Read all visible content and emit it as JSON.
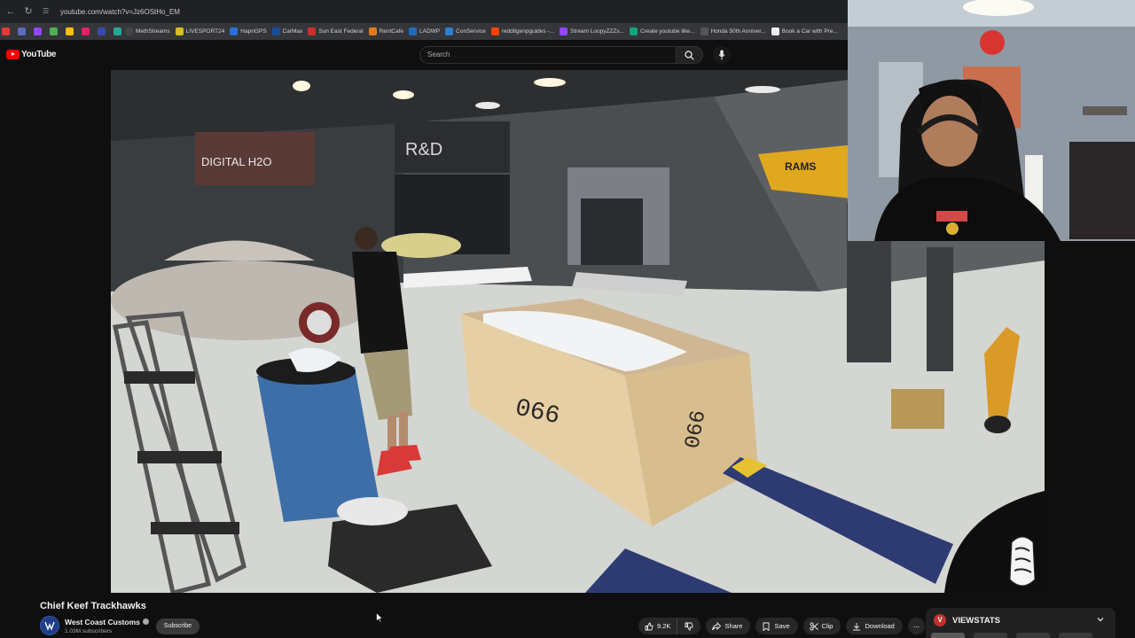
{
  "browser": {
    "url": "youtube.com/watch?v=Jz6OStHo_EM",
    "bookmarks": [
      {
        "label": "MethStreams",
        "color": "#444"
      },
      {
        "label": "LIVESPORT24",
        "color": "#d4c020"
      },
      {
        "label": "HapnGPS",
        "color": "#2a6fdb"
      },
      {
        "label": "CarMax",
        "color": "#1a4c9c"
      },
      {
        "label": "Sun East Federal",
        "color": "#c9302c"
      },
      {
        "label": "RentCafe",
        "color": "#e07b1a"
      },
      {
        "label": "LADWP",
        "color": "#1e6bbf"
      },
      {
        "label": "ConService",
        "color": "#2d7fd0"
      },
      {
        "label": "redditgenpguides -...",
        "color": "#ff4500"
      },
      {
        "label": "Stream LoopyZZZs...",
        "color": "#9146ff"
      },
      {
        "label": "Create youtube like...",
        "color": "#10a37f"
      },
      {
        "label": "Honda 50th Anniver...",
        "color": "#555"
      },
      {
        "label": "Book a Car with Pre...",
        "color": "#eee"
      }
    ],
    "extension_icons": [
      "#e53935",
      "#5c6bc0",
      "#9146ff",
      "#4caf50",
      "#ffc107",
      "#e91e63",
      "#3949ab",
      "#26a69a"
    ]
  },
  "youtube": {
    "logo_text": "YouTube",
    "search_placeholder": "Search"
  },
  "video": {
    "title": "Chief Keef Trackhawks",
    "crate_label": "066",
    "shop_signs": [
      "DIGITAL H2O",
      "R&D",
      "RAMS"
    ]
  },
  "channel": {
    "name": "West Coast Customs",
    "subscribers": "1.03M subscribers",
    "subscribe_label": "Subscribe"
  },
  "actions": {
    "likes": "9.2K",
    "share": "Share",
    "save": "Save",
    "clip": "Clip",
    "download": "Download",
    "more": "..."
  },
  "viewstats": {
    "logo": "V",
    "title": "VIEWSTATS"
  },
  "colors": {
    "yt_red": "#ff0000",
    "background": "#0f0f0f",
    "pill": "#272727"
  }
}
